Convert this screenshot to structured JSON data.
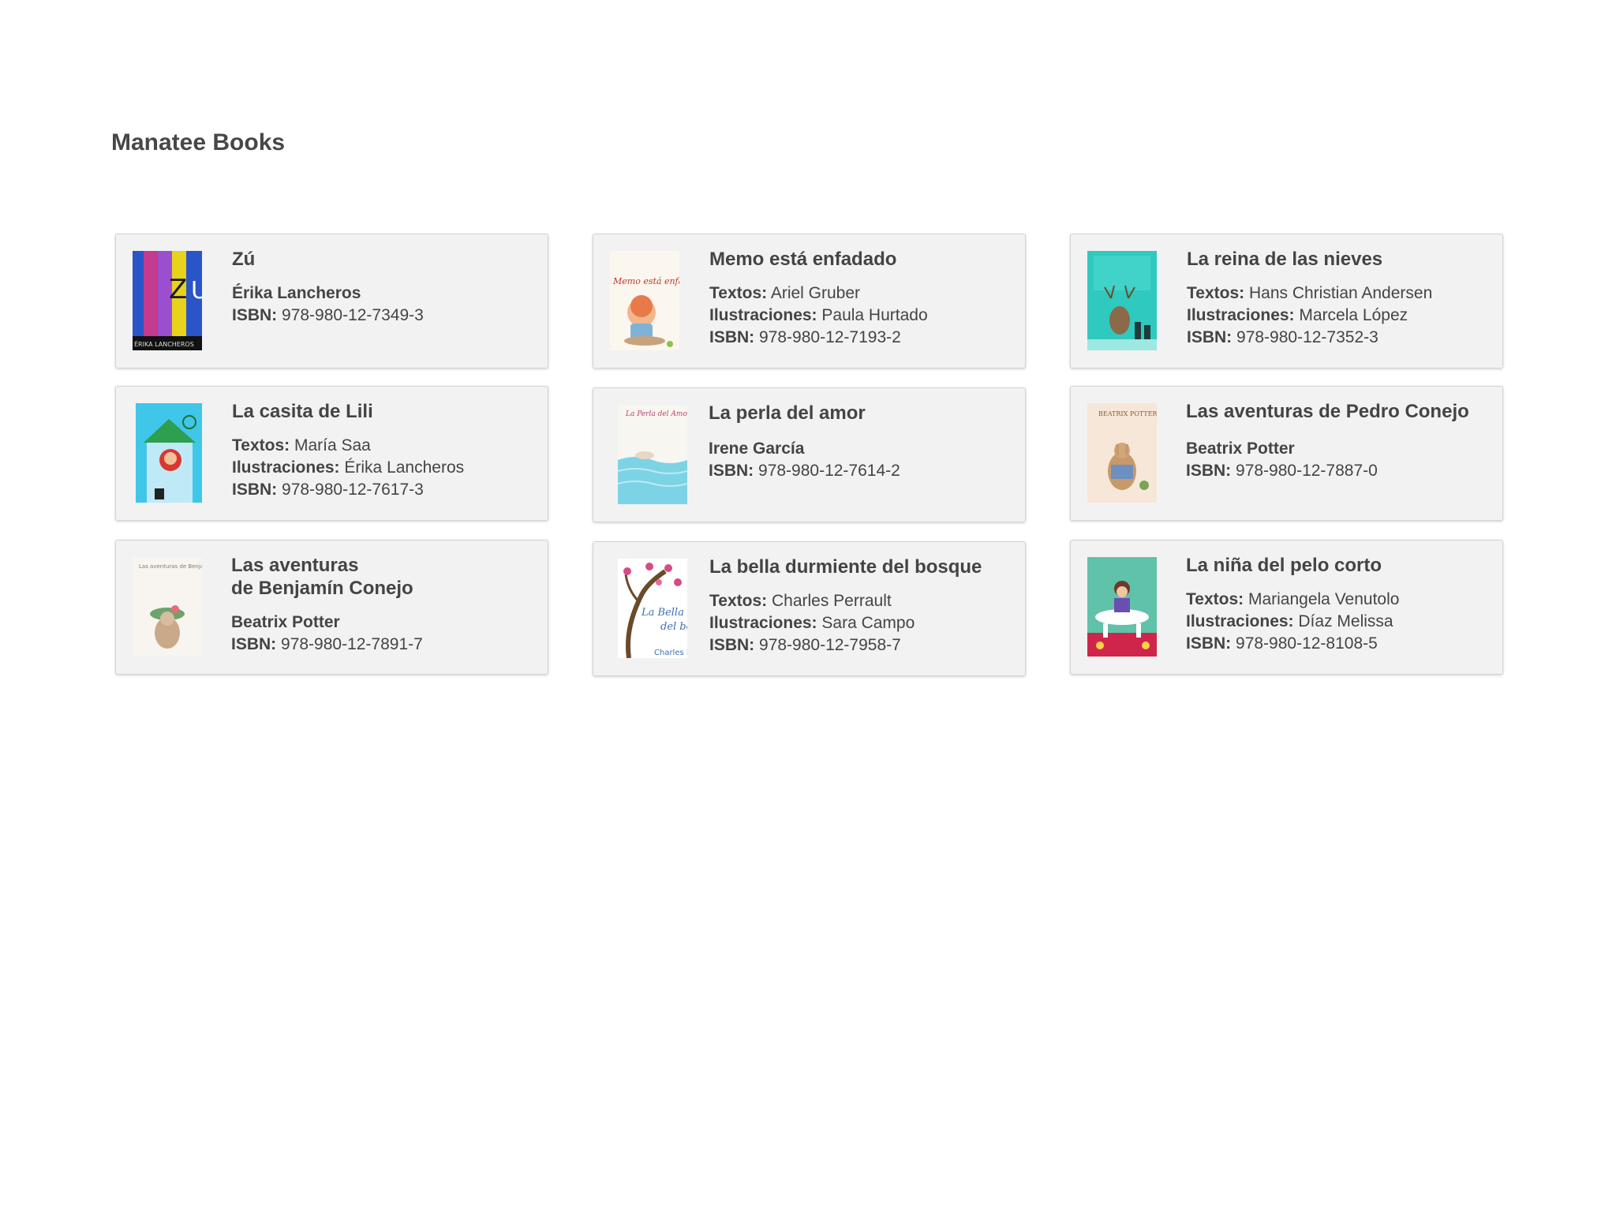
{
  "site": {
    "title": "Manatee Books"
  },
  "labels": {
    "textos": "Textos:",
    "ilustraciones": "Ilustraciones:",
    "isbn": "ISBN:"
  },
  "books": [
    {
      "title": "Zú",
      "author": "Érika Lancheros",
      "isbn": "978-980-12-7349-3",
      "cover": {
        "icon": "book-cover-zu",
        "text": "ÉRIKA LANCHEROS"
      }
    },
    {
      "title": "Memo está enfadado",
      "textos": "Ariel Gruber",
      "ilustraciones": "Paula Hurtado",
      "isbn": "978-980-12-7193-2",
      "cover": {
        "icon": "book-cover-memo",
        "text": "Memo está enfadado"
      }
    },
    {
      "title": "La reina de las nieves",
      "textos": "Hans Christian Andersen",
      "ilustraciones": "Marcela López",
      "isbn": "978-980-12-7352-3",
      "cover": {
        "icon": "book-cover-reina"
      }
    },
    {
      "title": "La casita de Lili",
      "textos": "María Saa",
      "ilustraciones": "Érika Lancheros",
      "isbn": "978-980-12-7617-3",
      "cover": {
        "icon": "book-cover-lili"
      }
    },
    {
      "title": "La perla del amor",
      "author": "Irene García",
      "isbn": "978-980-12-7614-2",
      "cover": {
        "icon": "book-cover-perla",
        "text": "La Perla del Amor"
      }
    },
    {
      "title": "Las aventuras de Pedro Conejo",
      "author": "Beatrix Potter",
      "isbn": "978-980-12-7887-0",
      "cover": {
        "icon": "book-cover-pedro",
        "text": "BEATRIX POTTER"
      }
    },
    {
      "title_line1": "Las aventuras",
      "title_line2": "de Benjamín Conejo",
      "author": "Beatrix Potter",
      "isbn": "978-980-12-7891-7",
      "cover": {
        "icon": "book-cover-benjamin",
        "text": "Las aventuras de Benjamín Conejo"
      }
    },
    {
      "title": "La bella durmiente del bosque",
      "textos": "Charles Perrault",
      "ilustraciones": "Sara Campo",
      "isbn": "978-980-12-7958-7",
      "cover": {
        "icon": "book-cover-bella",
        "text": "La Bella d del bo"
      }
    },
    {
      "title": "La niña del pelo corto",
      "textos": "Mariangela Venutolo",
      "ilustraciones": "Díaz Melissa",
      "isbn": "978-980-12-8108-5",
      "cover": {
        "icon": "book-cover-nina"
      }
    }
  ]
}
